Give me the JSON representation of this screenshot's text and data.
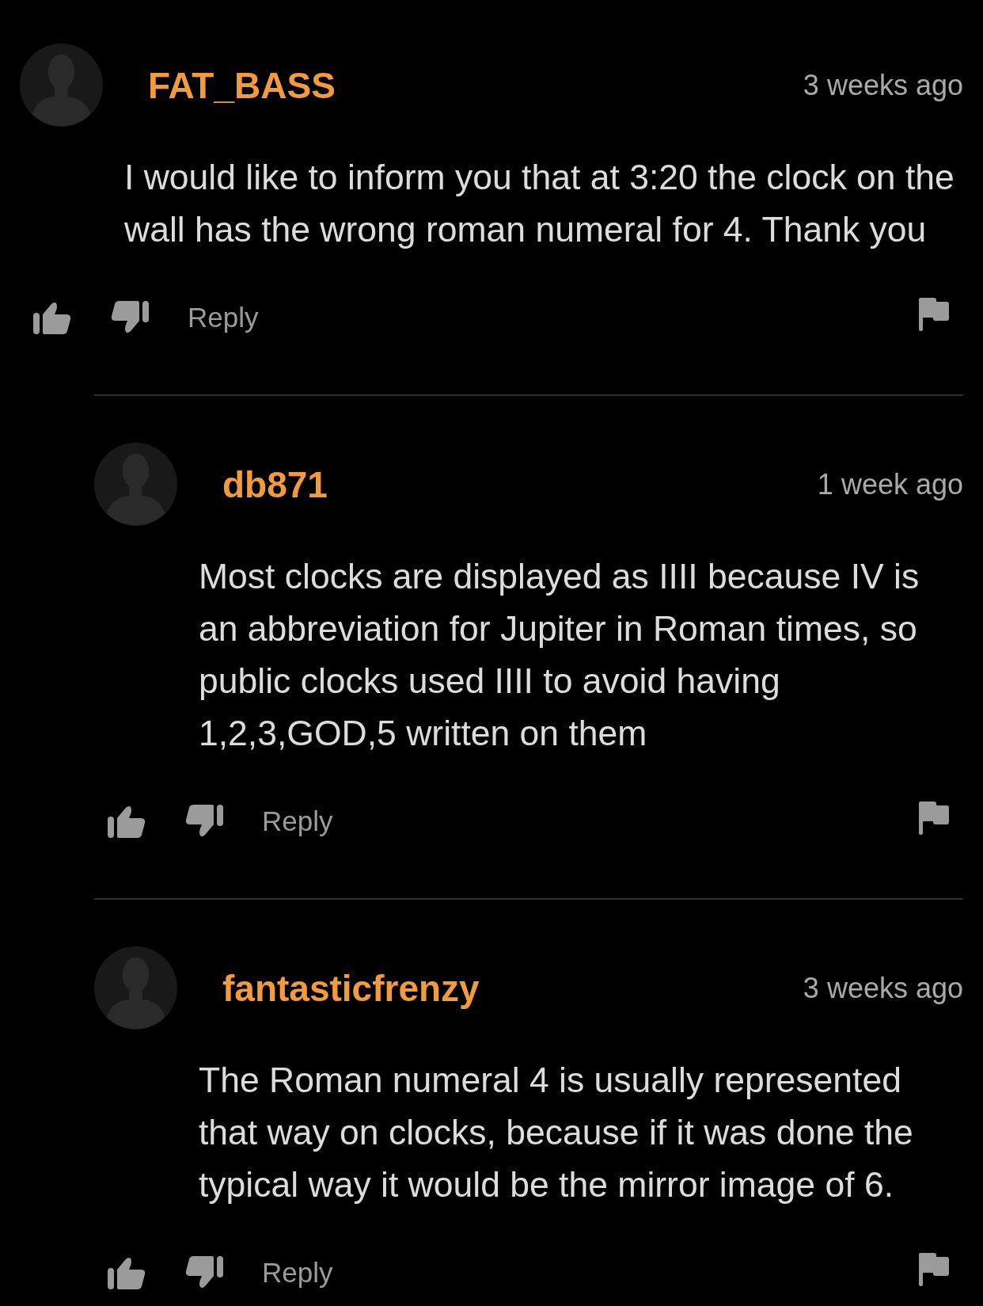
{
  "comments": [
    {
      "author": "FAT_BASS",
      "time": "3 weeks ago",
      "text": "I would like to inform you that at 3:20 the clock on the wall has the wrong roman numeral for 4. Thank you",
      "reply_label": "Reply",
      "replies": [
        {
          "author": "db871",
          "time": "1 week ago",
          "text": "Most clocks are displayed as IIII because IV is an abbreviation for Jupiter in Roman times, so public clocks used IIII to avoid having 1,2,3,GOD,5 written on them",
          "reply_label": "Reply"
        },
        {
          "author": "fantasticfrenzy",
          "time": "3 weeks ago",
          "text": "The Roman numeral 4 is usually represented that way on clocks, because if it was done the typical way it would be the mirror image of 6.",
          "reply_label": "Reply"
        }
      ]
    }
  ]
}
